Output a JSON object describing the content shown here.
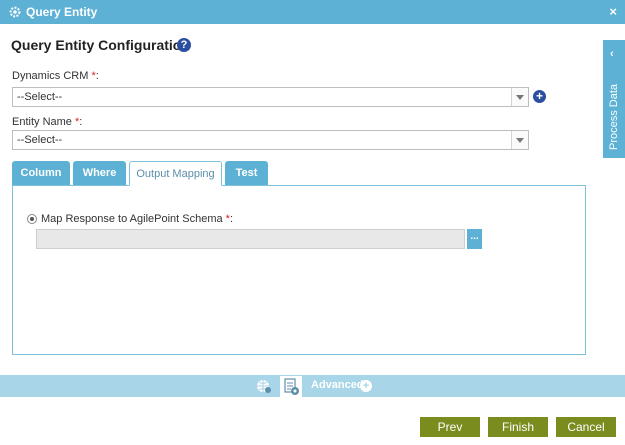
{
  "window": {
    "title": "Query Entity",
    "close_label": "×"
  },
  "page": {
    "heading": "Query Entity Configuration",
    "help_label": "?"
  },
  "form": {
    "crm_label": "Dynamics CRM ",
    "crm_required": "*",
    "crm_colon": ":",
    "crm_value": "--Select--",
    "crm_add_label": "+",
    "entity_label": "Entity Name ",
    "entity_required": "*",
    "entity_colon": ":",
    "entity_value": "--Select--"
  },
  "tabs": [
    {
      "label": "Column",
      "active": false
    },
    {
      "label": "Where",
      "active": false
    },
    {
      "label": "Output Mapping",
      "active": true
    },
    {
      "label": "Test",
      "active": false
    }
  ],
  "output_mapping": {
    "radio_label": "Map Response to AgilePoint Schema ",
    "radio_required": "*",
    "radio_colon": ":",
    "schema_value": "",
    "ellipsis_label": "..."
  },
  "side_panel": {
    "label": "Process Data",
    "chevron": "‹"
  },
  "footer": {
    "advanced_label": "Advanced",
    "advanced_plus": "+"
  },
  "buttons": {
    "prev": "Prev",
    "finish": "Finish",
    "cancel": "Cancel"
  },
  "colors": {
    "accent": "#5cb1d4",
    "button": "#7b8c1f",
    "required": "#e02020",
    "help": "#2a4fa1"
  }
}
